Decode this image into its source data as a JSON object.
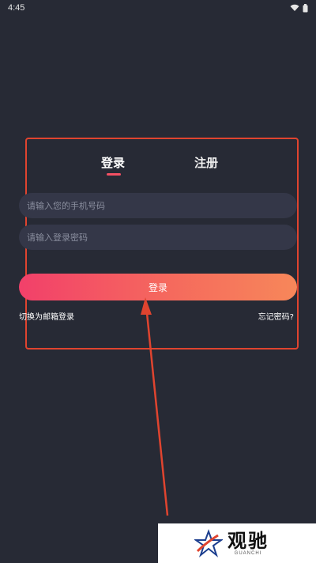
{
  "status_bar": {
    "time": "4:45"
  },
  "tabs": {
    "login": "登录",
    "register": "注册"
  },
  "form": {
    "phone_placeholder": "请输入您的手机号码",
    "password_placeholder": "请输入登录密码",
    "login_button": "登录"
  },
  "links": {
    "switch_email": "切换为邮箱登录",
    "forgot_password": "忘记密码?"
  },
  "watermark": {
    "brand": "观驰",
    "sub": "GUANCHI"
  },
  "colors": {
    "background": "#272a35",
    "accent": "#f45063",
    "highlight": "#e0442f"
  }
}
